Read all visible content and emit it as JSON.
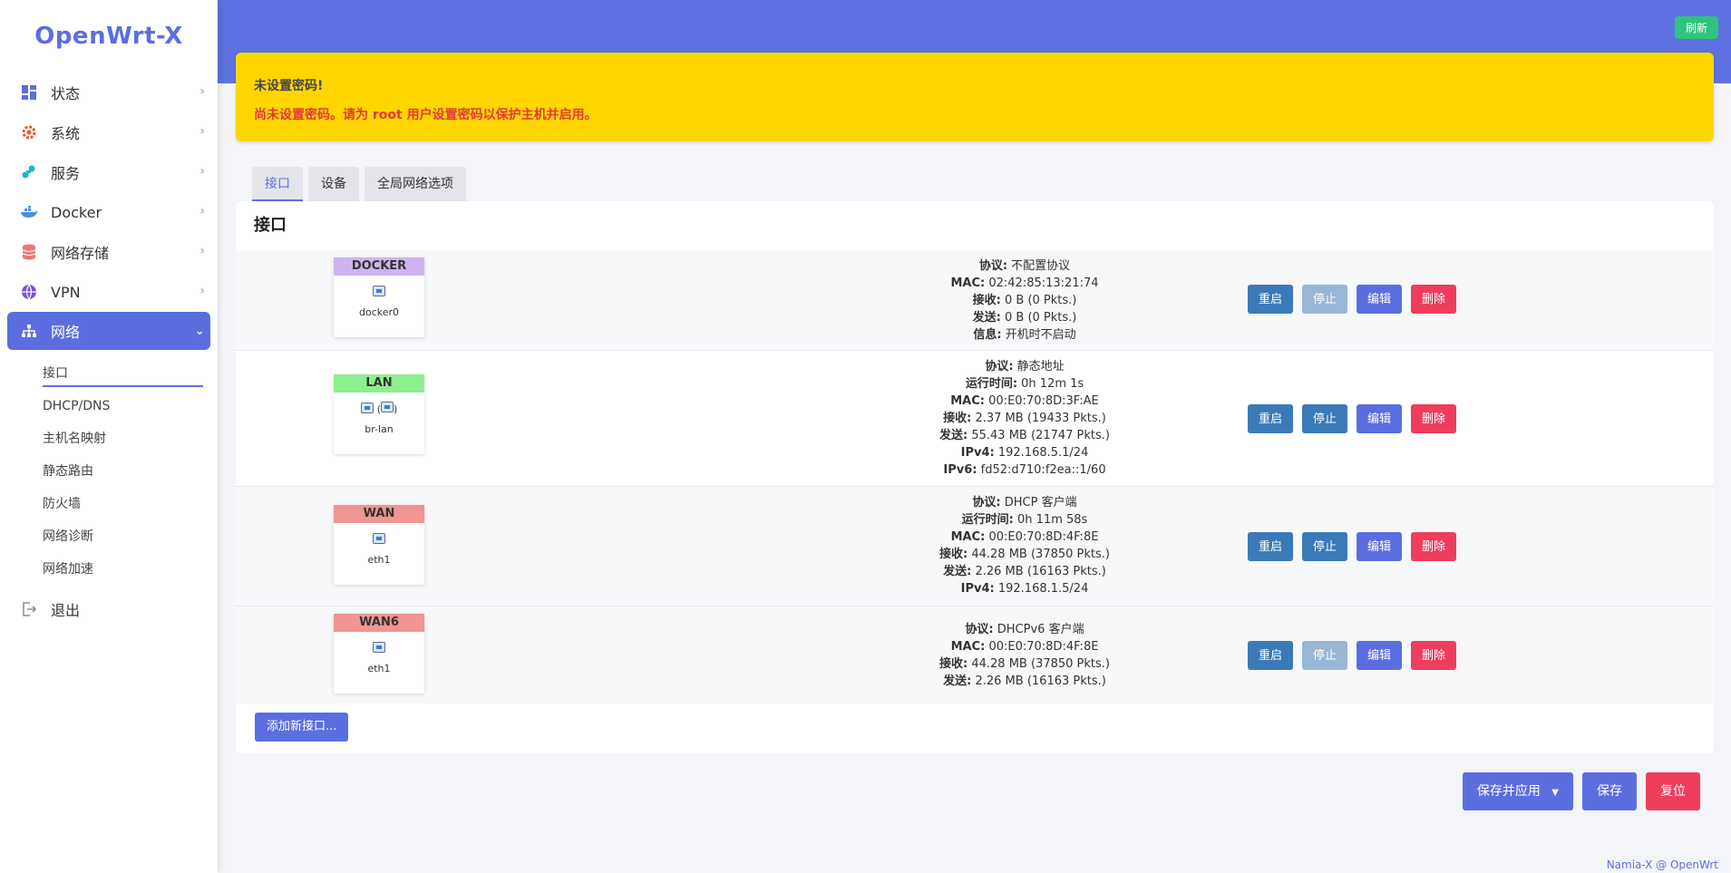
{
  "brand": "OpenWrt-X",
  "header": {
    "refresh_label": "刷新"
  },
  "sidebar": {
    "items": [
      {
        "label": "状态"
      },
      {
        "label": "系统"
      },
      {
        "label": "服务"
      },
      {
        "label": "Docker"
      },
      {
        "label": "网络存储"
      },
      {
        "label": "VPN"
      },
      {
        "label": "网络"
      }
    ],
    "network_sub": [
      "接口",
      "DHCP/DNS",
      "主机名映射",
      "静态路由",
      "防火墙",
      "网络诊断",
      "网络加速"
    ],
    "logout": "退出"
  },
  "warning": {
    "title": "未设置密码!",
    "message": "尚未设置密码。请为 root 用户设置密码以保护主机并启用。"
  },
  "tabs": [
    "接口",
    "设备",
    "全局网络选项"
  ],
  "panel_title": "接口",
  "interfaces": [
    {
      "name": "DOCKER",
      "color": "#cdb4f0",
      "device": "docker0",
      "lines": [
        {
          "k": "协议:",
          "v": "不配置协议"
        },
        {
          "k": "MAC:",
          "v": "02:42:85:13:21:74"
        },
        {
          "k": "接收:",
          "v": "0 B (0 Pkts.)"
        },
        {
          "k": "发送:",
          "v": "0 B (0 Pkts.)"
        },
        {
          "k": "信息:",
          "v": "开机时不启动"
        }
      ]
    },
    {
      "name": "LAN",
      "color": "#8fee8f",
      "device": "br-lan",
      "lines": [
        {
          "k": "协议:",
          "v": "静态地址"
        },
        {
          "k": "运行时间:",
          "v": "0h 12m 1s"
        },
        {
          "k": "MAC:",
          "v": "00:E0:70:8D:3F:AE"
        },
        {
          "k": "接收:",
          "v": "2.37 MB (19433 Pkts.)"
        },
        {
          "k": "发送:",
          "v": "55.43 MB (21747 Pkts.)"
        },
        {
          "k": "IPv4:",
          "v": "192.168.5.1/24"
        },
        {
          "k": "IPv6:",
          "v": "fd52:d710:f2ea::1/60"
        }
      ]
    },
    {
      "name": "WAN",
      "color": "#f09494",
      "device": "eth1",
      "lines": [
        {
          "k": "协议:",
          "v": "DHCP 客户端"
        },
        {
          "k": "运行时间:",
          "v": "0h 11m 58s"
        },
        {
          "k": "MAC:",
          "v": "00:E0:70:8D:4F:8E"
        },
        {
          "k": "接收:",
          "v": "44.28 MB (37850 Pkts.)"
        },
        {
          "k": "发送:",
          "v": "2.26 MB (16163 Pkts.)"
        },
        {
          "k": "IPv4:",
          "v": "192.168.1.5/24"
        }
      ]
    },
    {
      "name": "WAN6",
      "color": "#f09494",
      "device": "eth1",
      "lines": [
        {
          "k": "协议:",
          "v": "DHCPv6 客户端"
        },
        {
          "k": "MAC:",
          "v": "00:E0:70:8D:4F:8E"
        },
        {
          "k": "接收:",
          "v": "44.28 MB (37850 Pkts.)"
        },
        {
          "k": "发送:",
          "v": "2.26 MB (16163 Pkts.)"
        }
      ]
    }
  ],
  "row_buttons": {
    "restart": "重启",
    "stop": "停止",
    "edit": "编辑",
    "delete": "删除"
  },
  "add_button": "添加新接口...",
  "bottom": {
    "apply": "保存并应用",
    "save": "保存",
    "reset": "复位"
  },
  "footer": "Namia-X @ OpenWrt",
  "colors": {
    "accent": "#5b6ee0",
    "warning_bg": "#ffd600",
    "danger": "#ef3d5c",
    "success": "#2ec47d"
  }
}
